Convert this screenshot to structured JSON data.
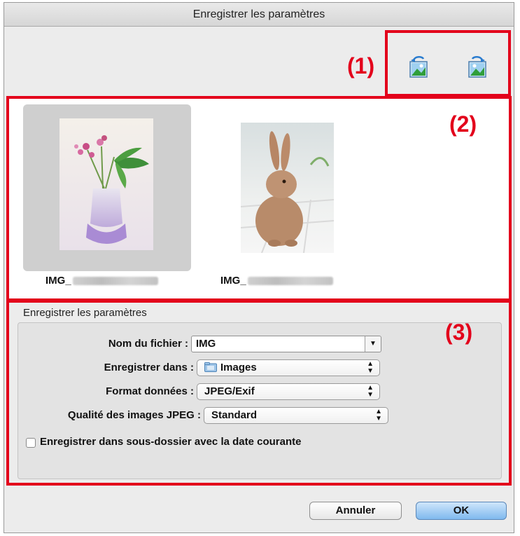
{
  "window": {
    "title": "Enregistrer les paramètres"
  },
  "markers": {
    "one": "(1)",
    "two": "(2)",
    "three": "(3)"
  },
  "toolbar": {
    "buttons": [
      {
        "icon": "rotate-left-icon"
      },
      {
        "icon": "rotate-right-icon"
      }
    ]
  },
  "thumbnails": [
    {
      "caption": "IMG_",
      "selected": true,
      "subject": "flowers-in-vase"
    },
    {
      "caption": "IMG_",
      "selected": false,
      "subject": "rabbit"
    }
  ],
  "settings": {
    "group_title": "Enregistrer les paramètres",
    "file_name": {
      "label": "Nom du fichier :",
      "value": "IMG"
    },
    "save_in": {
      "label": "Enregistrer dans :",
      "value": "Images"
    },
    "data_format": {
      "label": "Format données :",
      "value": "JPEG/Exif"
    },
    "jpeg_quality": {
      "label": "Qualité des images JPEG :",
      "value": "Standard"
    },
    "subfolder": {
      "label": "Enregistrer dans sous-dossier avec la date courante",
      "checked": false
    }
  },
  "buttons": {
    "cancel": "Annuler",
    "ok": "OK"
  },
  "colors": {
    "highlight_red": "#e3001b",
    "ok_blue": "#7fb9ee"
  }
}
